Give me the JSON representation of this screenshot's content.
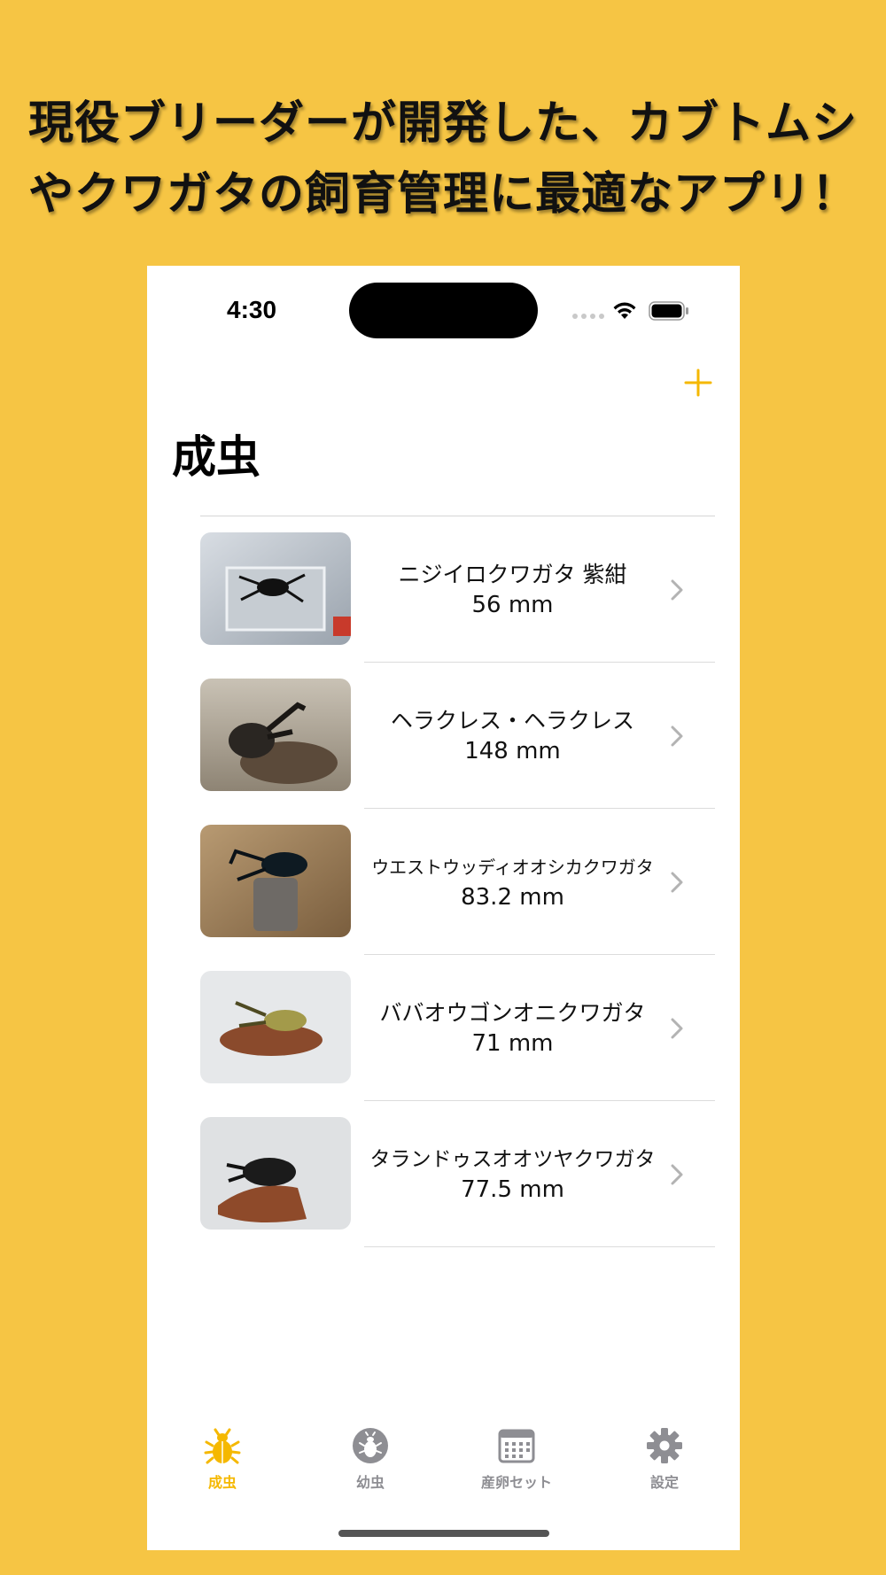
{
  "headline": {
    "line1": "現役ブリーダーが開発した、カブトムシ",
    "line2": "やクワガタの飼育管理に最適なアプリ！"
  },
  "status_bar": {
    "time": "4:30"
  },
  "nav": {
    "title": "成虫",
    "add_icon": "plus-icon"
  },
  "colors": {
    "background": "#F6C544",
    "accent": "#F5B800",
    "tab_inactive": "#8e8e93"
  },
  "adults": [
    {
      "name": "ニジイロクワガタ 紫紺",
      "size": "56 mm"
    },
    {
      "name": "ヘラクレス・ヘラクレス",
      "size": "148 mm"
    },
    {
      "name": "ウエストウッディオオシカクワガタ",
      "size": "83.2 mm"
    },
    {
      "name": "ババオウゴンオニクワガタ",
      "size": "71 mm"
    },
    {
      "name": "タランドゥスオオツヤクワガタ",
      "size": "77.5 mm"
    }
  ],
  "tabs": [
    {
      "label": "成虫",
      "icon": "beetle-icon",
      "active": true
    },
    {
      "label": "幼虫",
      "icon": "larva-icon",
      "active": false
    },
    {
      "label": "産卵セット",
      "icon": "calendar-icon",
      "active": false
    },
    {
      "label": "設定",
      "icon": "gear-icon",
      "active": false
    }
  ]
}
